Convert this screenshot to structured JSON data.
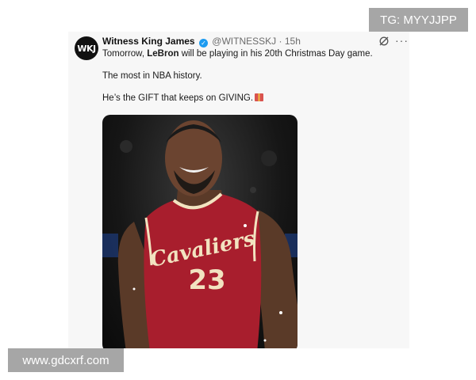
{
  "watermarks": {
    "top": "TG: MYYJJPP",
    "bottom": "www.gdcxrf.com"
  },
  "tweet": {
    "avatar_text": "WKJ",
    "author_name": "Witness King James",
    "handle": "@WITNESSKJ",
    "separator": "·",
    "time": "15h",
    "line1_before": "Tomorrow, ",
    "line1_bold": "LeBron",
    "line1_after": " will be playing in his 20th Christmas Day game.",
    "line2": "The most in NBA history.",
    "line3": "He’s the GIFT that keeps on GIVING.",
    "more_label": "···"
  },
  "photo": {
    "jersey_text": "Cavaliers",
    "jersey_number": "23"
  },
  "colors": {
    "verified": "#1d9bf0",
    "jersey": "#a81e2d",
    "accent": "#f2e3c0"
  },
  "icons": [
    "verified-badge-icon",
    "sync-icon",
    "more-icon",
    "gift-icon"
  ]
}
